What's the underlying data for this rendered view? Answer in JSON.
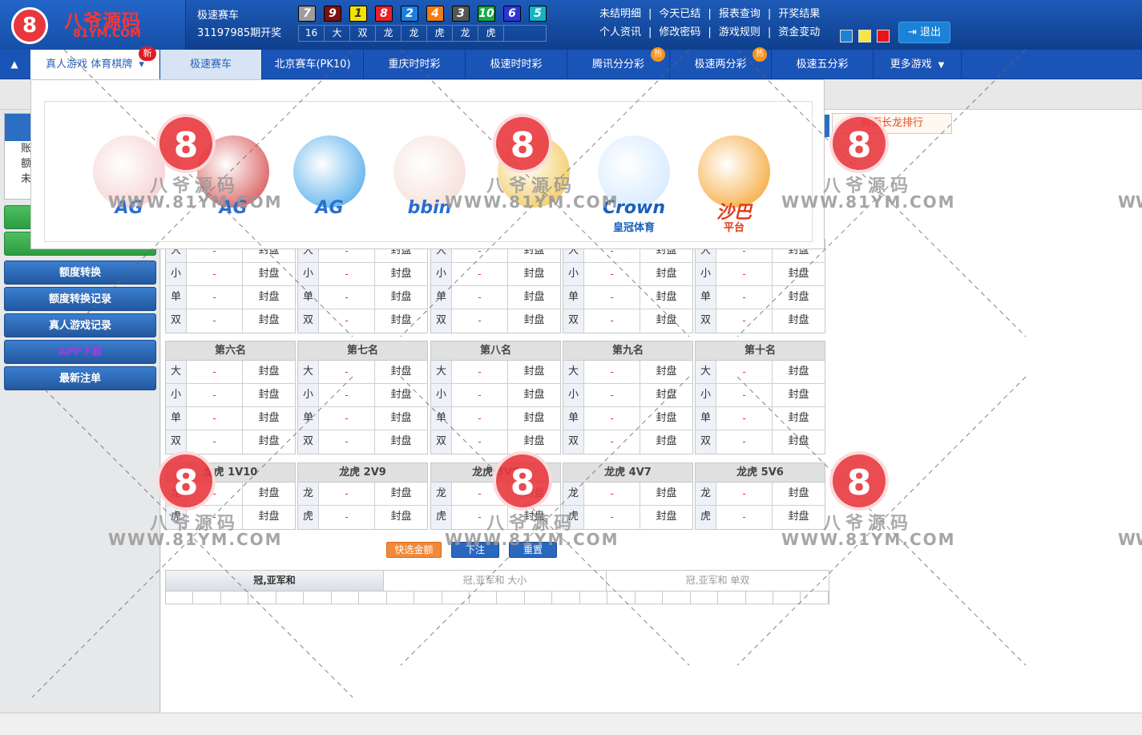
{
  "brand": {
    "name": "八爷源码",
    "domain": "81YM.COM",
    "logo_glyph": "8"
  },
  "draw": {
    "game": "极速赛车",
    "issue": "31197985期开奖"
  },
  "result_balls": [
    {
      "n": "7",
      "color": "#9e9e9e"
    },
    {
      "n": "9",
      "color": "#7a1010"
    },
    {
      "n": "1",
      "color": "#f2e300"
    },
    {
      "n": "8",
      "color": "#e8202a"
    },
    {
      "n": "2",
      "color": "#1d7fe0"
    },
    {
      "n": "4",
      "color": "#f07c14"
    },
    {
      "n": "3",
      "color": "#555555"
    },
    {
      "n": "10",
      "color": "#16a84a"
    },
    {
      "n": "6",
      "color": "#2a35d6"
    },
    {
      "n": "5",
      "color": "#12b5c4"
    }
  ],
  "result_tags": [
    "16",
    "大",
    "双",
    "龙",
    "龙",
    "虎",
    "龙",
    "虎"
  ],
  "top_links_row1": [
    "未结明细",
    "今天已结",
    "报表查询",
    "开奖结果"
  ],
  "top_links_row2": [
    "个人资讯",
    "修改密码",
    "游戏规则",
    "资金变动"
  ],
  "theme_colors": [
    "#1b82d7",
    "#f5e642",
    "#e8151a"
  ],
  "logout_label": "退出",
  "nav": {
    "live_sports": "真人游戏 体育棋牌",
    "new_badge": "新",
    "items": [
      "极速赛车",
      "北京赛车(PK10)",
      "重庆时时彩",
      "极速时时彩",
      "腾讯分分彩",
      "极速两分彩",
      "极速五分彩",
      "更多游戏"
    ],
    "hot_badge": "热"
  },
  "popup_games": [
    {
      "label": "AG",
      "color": "#2a6fd0",
      "art": "#f5c6c6"
    },
    {
      "label": "AG",
      "color": "#2a6fd0",
      "art": "#d23a3a"
    },
    {
      "label": "AG",
      "color": "#2a6fd0",
      "art": "#3aa0e8"
    },
    {
      "label": "bbin",
      "color": "#2a6fd0",
      "art": "#f4d8d0"
    },
    {
      "label": "",
      "color": "#c02020",
      "art": "#f0c040"
    },
    {
      "label": "Crown",
      "color": "#1a5fb8",
      "art": "#cce6ff"
    },
    {
      "label": "沙巴",
      "color": "#e03a1a",
      "art": "#f59a1a"
    }
  ],
  "popup_subtitles": [
    "",
    "",
    "",
    "",
    "",
    "皇冠体育",
    "平台"
  ],
  "account_rows": [
    "账",
    "额",
    "未"
  ],
  "side_buttons": [
    "额度转换",
    "额度转换记录",
    "真人游戏记录",
    "APP下载",
    "最新注单"
  ],
  "long_rank": "两面长龙排行",
  "row_labels": [
    "大",
    "小",
    "单",
    "双"
  ],
  "odds_placeholder": "-",
  "status_closed": "封盘",
  "top_groups": [
    "",
    "",
    "",
    "",
    ""
  ],
  "mid_groups": [
    "第六名",
    "第七名",
    "第八名",
    "第九名",
    "第十名"
  ],
  "dt_groups": [
    "龙虎 1V10",
    "龙虎 2V9",
    "龙虎 3V8",
    "龙虎 4V7",
    "龙虎 5V6"
  ],
  "dt_labels": [
    "龙",
    "虎"
  ],
  "actions": {
    "quick": "快选金额",
    "bet": "下注",
    "reset": "重置"
  },
  "stats": {
    "title": "冠,亚军和",
    "col2": "冠,亚军和 大小",
    "col3": "冠,亚军和 单双"
  },
  "watermark": {
    "cn": "八爷源码",
    "url": "WWW.81YM.COM"
  }
}
